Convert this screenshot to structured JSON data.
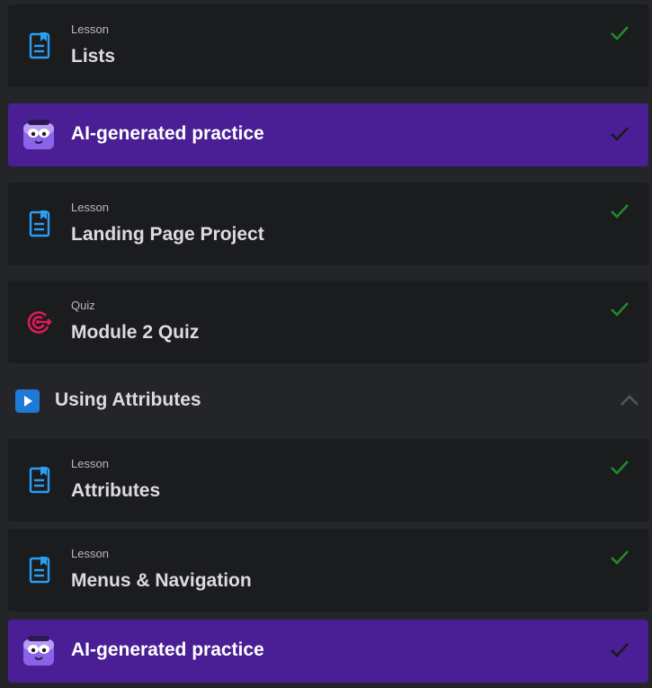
{
  "items": [
    {
      "kind": "Lesson",
      "title": "Lists",
      "type": "lesson",
      "completed": true
    },
    {
      "kind": "",
      "title": "AI-generated practice",
      "type": "practice",
      "completed": true
    },
    {
      "kind": "Lesson",
      "title": "Landing Page Project",
      "type": "lesson",
      "completed": true
    },
    {
      "kind": "Quiz",
      "title": "Module 2 Quiz",
      "type": "quiz",
      "completed": true
    }
  ],
  "section": {
    "title": "Using Attributes",
    "expanded": true
  },
  "section_items": [
    {
      "kind": "Lesson",
      "title": "Attributes",
      "type": "lesson",
      "completed": true
    },
    {
      "kind": "Lesson",
      "title": "Menus & Navigation",
      "type": "lesson",
      "completed": true
    },
    {
      "kind": "",
      "title": "AI-generated practice",
      "type": "practice",
      "completed": true
    }
  ],
  "colors": {
    "lesson_icon": "#2a9df4",
    "quiz_icon": "#e0195a",
    "check_done": "#1f8a2e",
    "practice_bg": "#4a1f95",
    "section_icon": "#1f7ad6"
  }
}
